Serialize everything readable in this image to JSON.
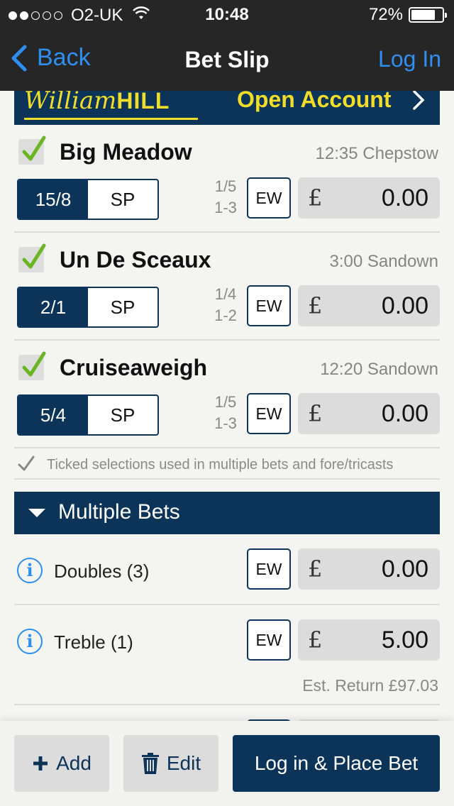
{
  "status_bar": {
    "carrier": "O2-UK",
    "time": "10:48",
    "battery": "72%",
    "signal_icon": "signal-dots-icon",
    "wifi_icon": "wifi-icon",
    "battery_icon": "battery-icon"
  },
  "nav": {
    "back_label": "Back",
    "title": "Bet Slip",
    "login_label": "Log In"
  },
  "banner": {
    "logo_italic": "William",
    "logo_bold": "HILL",
    "cta": "Open Account",
    "cta_icon": "chevron-right-icon"
  },
  "selections": [
    {
      "name": "Big Meadow",
      "info": "12:35 Chepstow",
      "price": "15/8",
      "sp": "SP",
      "terms_top": "1/5",
      "terms_bottom": "1-3",
      "ew": "EW",
      "currency": "£",
      "stake": "0.00",
      "checked": true
    },
    {
      "name": "Un De Sceaux",
      "info": "3:00 Sandown",
      "price": "2/1",
      "sp": "SP",
      "terms_top": "1/4",
      "terms_bottom": "1-2",
      "ew": "EW",
      "currency": "£",
      "stake": "0.00",
      "checked": true
    },
    {
      "name": "Cruiseaweigh",
      "info": "12:20 Sandown",
      "price": "5/4",
      "sp": "SP",
      "terms_top": "1/5",
      "terms_bottom": "1-3",
      "ew": "EW",
      "currency": "£",
      "stake": "0.00",
      "checked": true
    }
  ],
  "note": "Ticked selections used in multiple bets and fore/tricasts",
  "multiples": {
    "header": "Multiple Bets",
    "rows": [
      {
        "label": "Doubles (3)",
        "ew": "EW",
        "currency": "£",
        "stake": "0.00"
      },
      {
        "label": "Treble (1)",
        "ew": "EW",
        "currency": "£",
        "stake": "5.00",
        "est_return": "Est. Return £97.03"
      }
    ]
  },
  "toolbar": {
    "add_label": "Add",
    "edit_label": "Edit",
    "place_label": "Log in & Place Bet"
  },
  "colors": {
    "brand_navy": "#0b3458",
    "link_blue": "#2e8ff0",
    "wh_yellow": "#f2dc2a",
    "check_green": "#6ab524",
    "chrome_dark": "#262626"
  }
}
